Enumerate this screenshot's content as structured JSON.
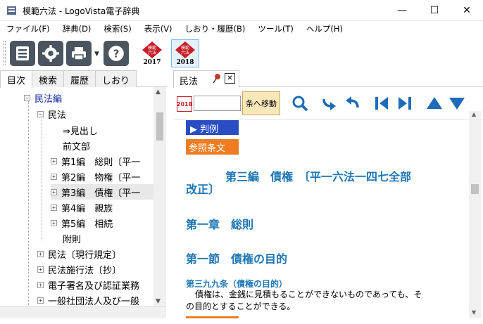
{
  "window": {
    "title": "模範六法 - LogoVista電子辞典",
    "minimize": "—",
    "maximize": "☐",
    "close": "✕"
  },
  "menu": [
    "ファイル(F)",
    "辞典(D)",
    "検索(S)",
    "表示(V)",
    "しおり・履歴(B)",
    "ツール(T)",
    "ヘルプ(H)"
  ],
  "toolbar": {
    "dict_2017_year": "2017",
    "dict_2018_year": "2018",
    "dict_label_top": "模範",
    "dict_label_bottom": "六法"
  },
  "left_tabs": [
    "目次",
    "検索",
    "履歴",
    "しおり"
  ],
  "tree": {
    "root": "民法編",
    "sub": "民法",
    "items": [
      "⇒見出し",
      "前文部",
      "第1編　総則〔平一",
      "第2編　物権〔平一",
      "第3編　債権〔平一",
      "第4編　親族",
      "第5編　相続",
      "附則"
    ],
    "others": [
      "民法〔現行規定〕",
      "民法施行法〔抄〕",
      "電子署名及び認証業務",
      "一般社団法人及び一般"
    ]
  },
  "right_tab": {
    "label": "民法"
  },
  "navbar": {
    "year": "2018",
    "article_input": "",
    "move_label": "条へ移動"
  },
  "content": {
    "hanrei": "▶ 判例",
    "sansho": "参照条文",
    "heading_line1": "第三編　債権　〔平一六法一四七全部",
    "heading_line2": "改正〕",
    "chapter": "第一章　総則",
    "section": "第一節　債権の目的",
    "article_title": "第三九九条（債権の目的）",
    "article_body_1": "債権は、金銭に見積もることができないものであっても、そ",
    "article_body_2": "の目的とすることができる。"
  },
  "colors": {
    "accent_blue": "#1f77b4",
    "tree_blue": "#0a2a9a",
    "hanrei_bg": "#2a4dc4",
    "sansho_bg": "#ee7d22",
    "toolbar_dark": "#4a5560"
  }
}
